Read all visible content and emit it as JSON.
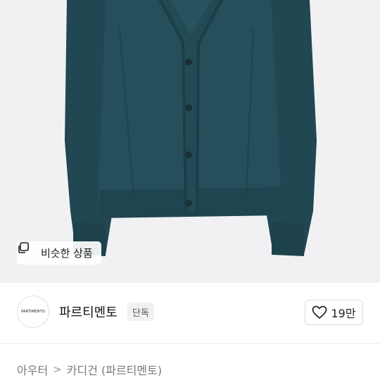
{
  "product": {
    "image_alt_icon": "cardigan-photo",
    "similar_button_label": "비슷한 상품"
  },
  "brand": {
    "logo_text": "PARTIMENTO",
    "name": "파르티멘토",
    "badge": "단독",
    "like_count": "19만"
  },
  "breadcrumb": {
    "level1": "아우터",
    "separator": ">",
    "level2": "카디건 (파르티멘토)"
  },
  "colors": {
    "garment": "#234a55",
    "background": "#f1f1f3"
  }
}
